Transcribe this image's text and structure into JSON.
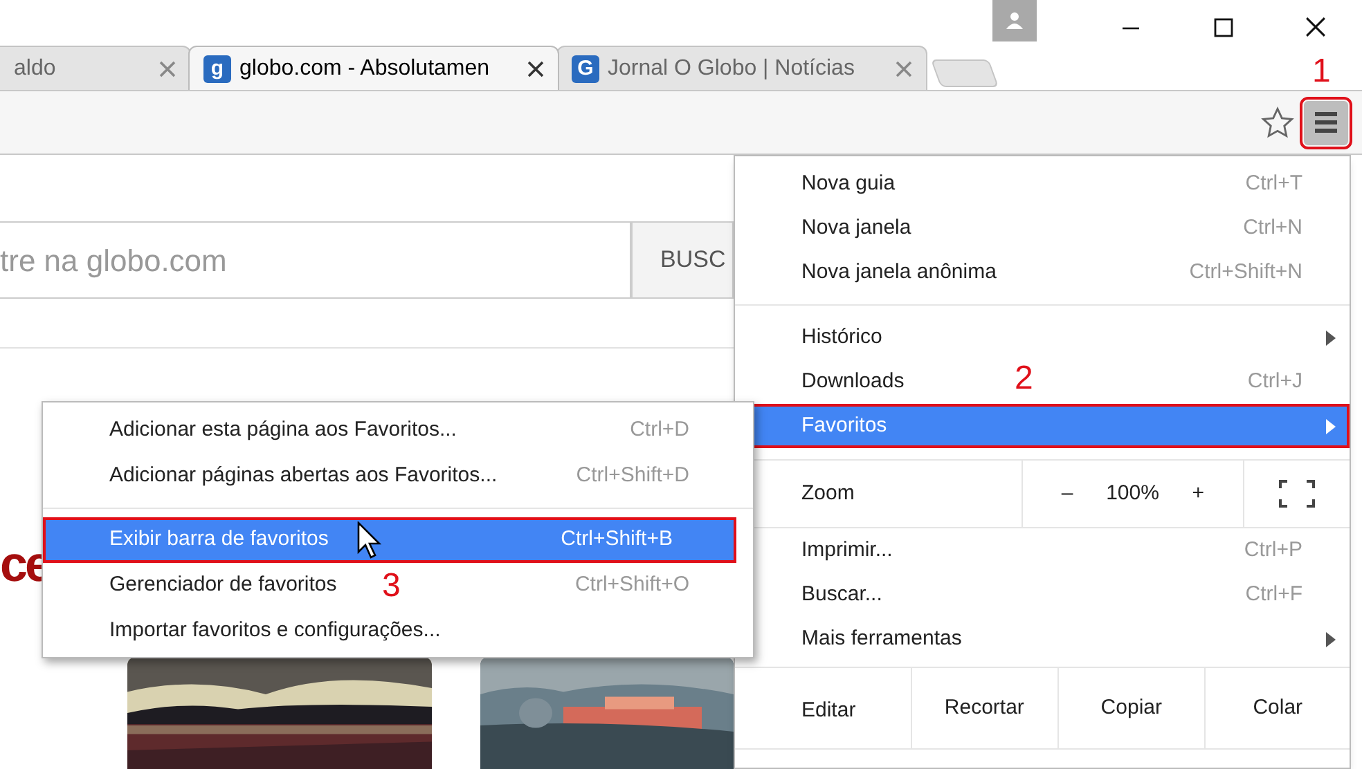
{
  "tabs": [
    {
      "title": "aldo",
      "selected": false
    },
    {
      "title": "globo.com - Absolutamen",
      "favicon": "g",
      "selected": true
    },
    {
      "title": "Jornal O Globo | Notícias",
      "favicon": "G",
      "selected": false
    }
  ],
  "page": {
    "search_placeholder": "tre na globo.com",
    "search_button": "BUSC",
    "headline_fragment": "ce"
  },
  "chrome_menu": {
    "items": [
      {
        "kind": "item",
        "label": "Nova guia",
        "shortcut": "Ctrl+T",
        "submenu": false,
        "selected": false
      },
      {
        "kind": "item",
        "label": "Nova janela",
        "shortcut": "Ctrl+N",
        "submenu": false,
        "selected": false
      },
      {
        "kind": "item",
        "label": "Nova janela anônima",
        "shortcut": "Ctrl+Shift+N",
        "submenu": false,
        "selected": false
      },
      {
        "kind": "separator"
      },
      {
        "kind": "item",
        "label": "Histórico",
        "submenu": true,
        "selected": false
      },
      {
        "kind": "item",
        "label": "Downloads",
        "shortcut": "Ctrl+J",
        "submenu": false,
        "selected": false
      },
      {
        "kind": "item",
        "label": "Favoritos",
        "submenu": true,
        "selected": true
      },
      {
        "kind": "zoom",
        "label": "Zoom",
        "minus": "–",
        "value": "100%",
        "plus": "+"
      },
      {
        "kind": "item",
        "label": "Imprimir...",
        "shortcut": "Ctrl+P",
        "submenu": false,
        "selected": false
      },
      {
        "kind": "item",
        "label": "Buscar...",
        "shortcut": "Ctrl+F",
        "submenu": false,
        "selected": false
      },
      {
        "kind": "item",
        "label": "Mais ferramentas",
        "submenu": true,
        "selected": false
      },
      {
        "kind": "edit",
        "label": "Editar",
        "buttons": [
          "Recortar",
          "Copiar",
          "Colar"
        ]
      }
    ]
  },
  "bookmarks_submenu": {
    "items": [
      {
        "kind": "item",
        "label": "Adicionar esta página aos Favoritos...",
        "shortcut": "Ctrl+D",
        "selected": false
      },
      {
        "kind": "item",
        "label": "Adicionar páginas abertas aos Favoritos...",
        "shortcut": "Ctrl+Shift+D",
        "selected": false
      },
      {
        "kind": "separator"
      },
      {
        "kind": "item",
        "label": "Exibir barra de favoritos",
        "shortcut": "Ctrl+Shift+B",
        "selected": true
      },
      {
        "kind": "item",
        "label": "Gerenciador de favoritos",
        "shortcut": "Ctrl+Shift+O",
        "selected": false
      },
      {
        "kind": "item",
        "label": "Importar favoritos e configurações...",
        "selected": false
      }
    ]
  },
  "annotations": [
    "1",
    "2",
    "3"
  ]
}
